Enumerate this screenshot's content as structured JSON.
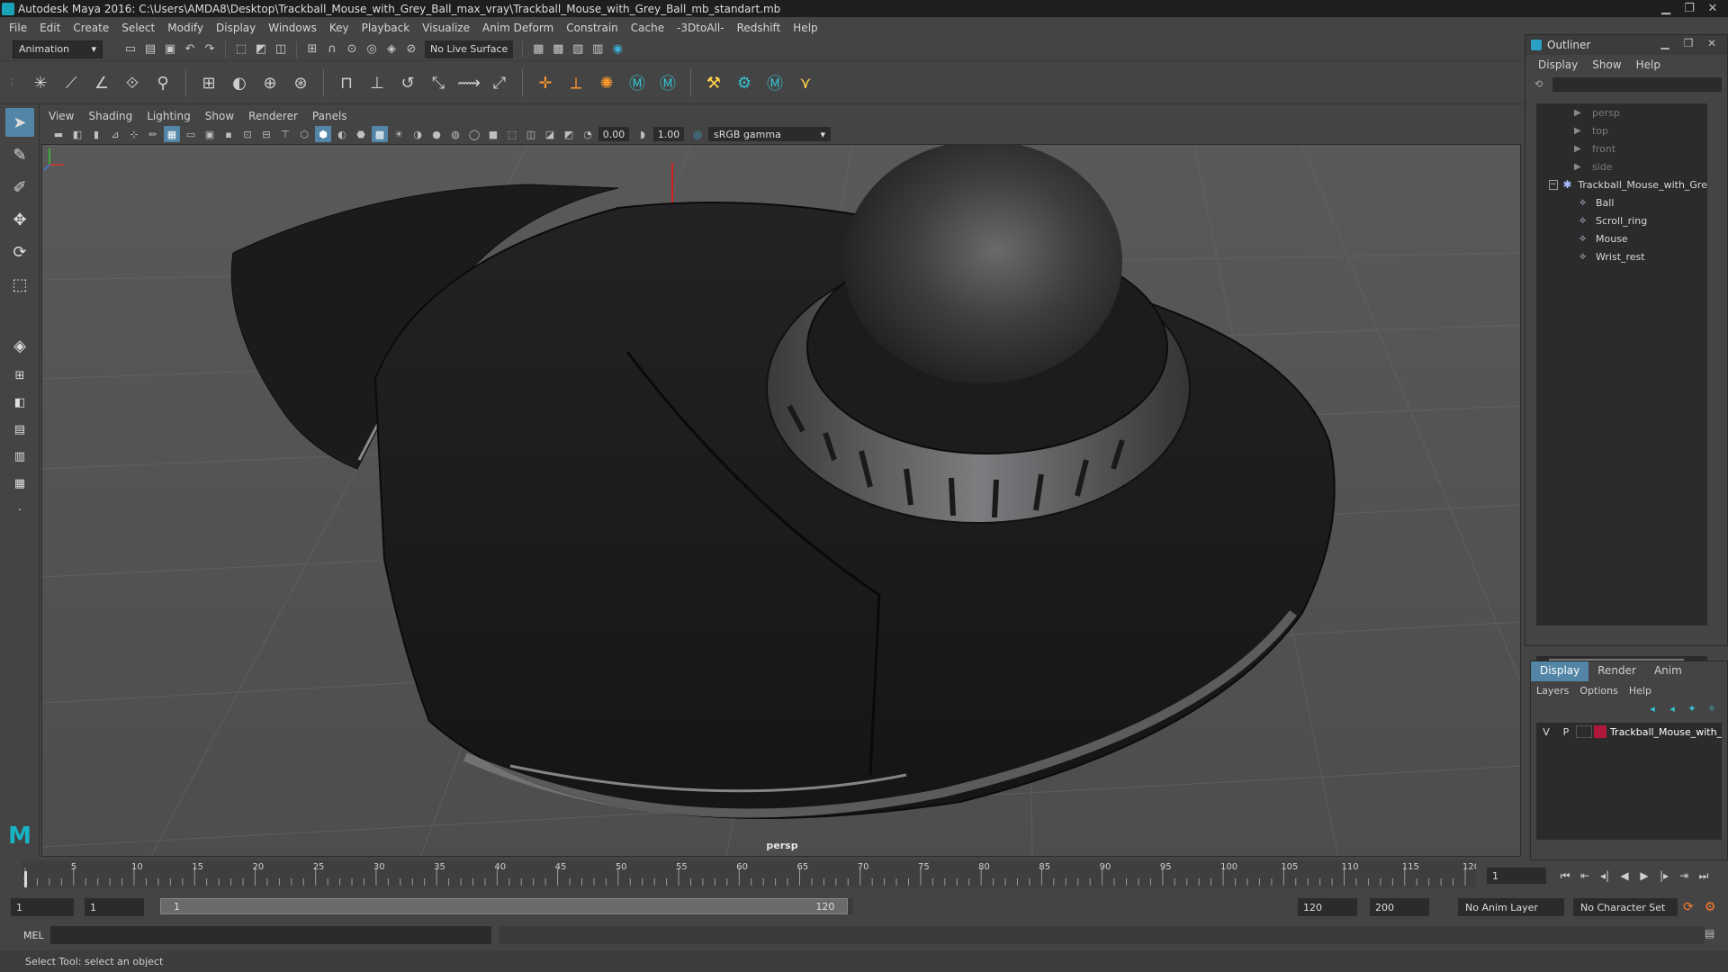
{
  "window": {
    "title": "Autodesk Maya 2016: C:\\Users\\AMDA8\\Desktop\\Trackball_Mouse_with_Grey_Ball_max_vray\\Trackball_Mouse_with_Grey_Ball_mb_standart.mb",
    "minimize": "▁",
    "maximize": "❐",
    "close": "✕"
  },
  "menu": [
    "File",
    "Edit",
    "Create",
    "Select",
    "Modify",
    "Display",
    "Windows",
    "Key",
    "Playback",
    "Visualize",
    "Anim Deform",
    "Constrain",
    "Cache",
    "-3DtoAll-",
    "Redshift",
    "Help"
  ],
  "status_line": {
    "mode": "Animation",
    "live_surface": "No Live Surface"
  },
  "panel": {
    "menu": [
      "View",
      "Shading",
      "Lighting",
      "Show",
      "Renderer",
      "Panels"
    ],
    "near_value": "0.00",
    "far_value": "1.00",
    "color_space": "sRGB gamma",
    "camera_label": "persp"
  },
  "outliner": {
    "title": "Outliner",
    "menu": [
      "Display",
      "Show",
      "Help"
    ],
    "cameras": [
      "persp",
      "top",
      "front",
      "side"
    ],
    "group": "Trackball_Mouse_with_Gre",
    "children": [
      "Ball",
      "Scroll_ring",
      "Mouse",
      "Wrist_rest"
    ]
  },
  "layers": {
    "tabs": [
      "Display",
      "Render",
      "Anim"
    ],
    "active_tab": "Display",
    "menu": [
      "Layers",
      "Options",
      "Help"
    ],
    "row": {
      "v": "V",
      "p": "P",
      "name": "Trackball_Mouse_with_",
      "color": "#b0173a"
    }
  },
  "timeline": {
    "ticks": [
      1,
      5,
      10,
      15,
      20,
      25,
      30,
      35,
      40,
      45,
      50,
      55,
      60,
      65,
      70,
      75,
      80,
      85,
      90,
      95,
      100,
      105,
      110,
      115,
      120
    ],
    "current_frame": "1",
    "range_min": 1,
    "range_max": 120
  },
  "range": {
    "start_time": "1",
    "playback_start": "1",
    "slider_start": "1",
    "slider_end": "120",
    "playback_end": "120",
    "end_time": "200",
    "anim_layer": "No Anim Layer",
    "character_set": "No Character Set"
  },
  "command": {
    "language": "MEL"
  },
  "help_line": "Select Tool: select an object",
  "colors": {
    "accent": "#5285a6",
    "maya_teal": "#17b4c4",
    "layer_red": "#b0173a"
  }
}
